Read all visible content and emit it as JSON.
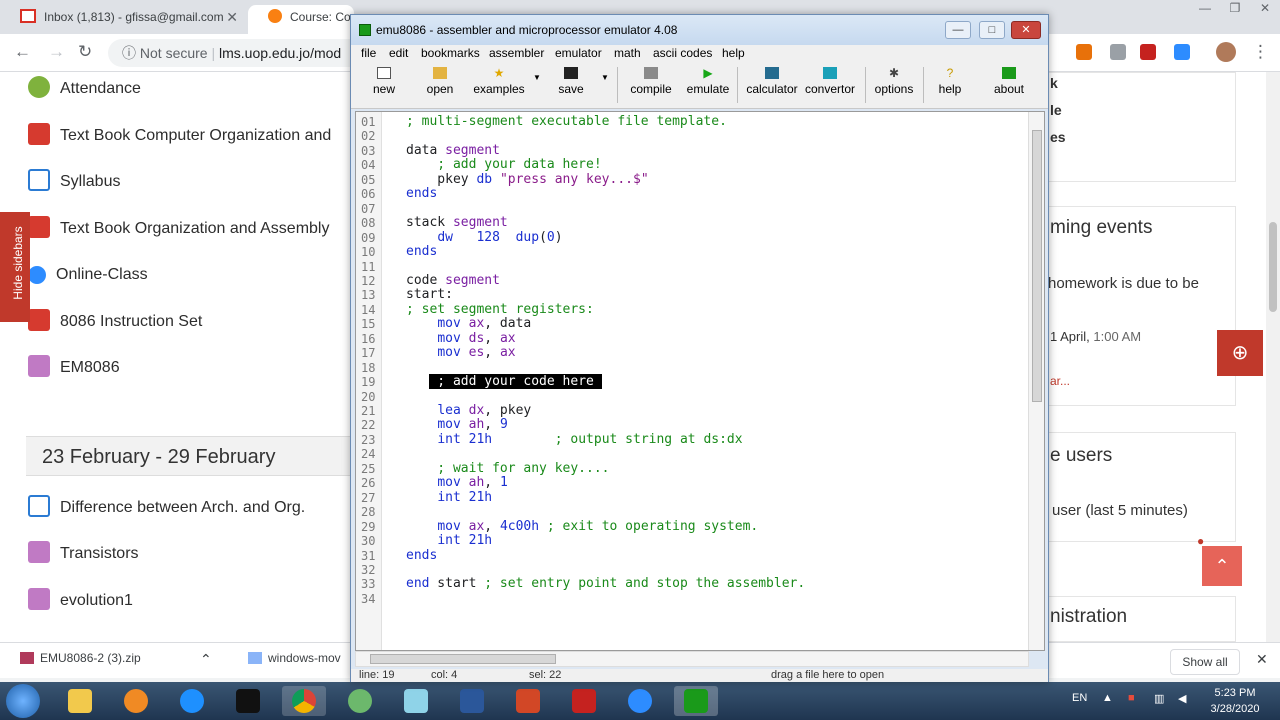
{
  "browser": {
    "tabs": [
      {
        "label": "Inbox (1,813) - gfissa@gmail.com",
        "icon": "gmail-icon"
      },
      {
        "label": "Course: Computer Organization",
        "icon": "moodle-icon"
      }
    ],
    "address": {
      "security": "Not secure",
      "url_domain": "lms.uop.edu.jo/mod"
    }
  },
  "moodle_nav": {
    "items": [
      {
        "label": "Attendance"
      },
      {
        "label": "Text Book Computer Organization and"
      },
      {
        "label": "Syllabus"
      },
      {
        "label": "Text Book Organization and Assembly"
      },
      {
        "label": "Online-Class"
      },
      {
        "label": "8086 Instruction Set"
      },
      {
        "label": "EM8086"
      }
    ],
    "week_header": "23 February - 29 February",
    "week_items": [
      {
        "label": "Difference between Arch. and Org."
      },
      {
        "label": "Transistors"
      },
      {
        "label": "evolution1"
      }
    ],
    "hide_sidebars": "Hide sidebars"
  },
  "right_panel": {
    "frag1": "k",
    "frag2": "le",
    "frag3": "es",
    "upcoming_title": "ming events",
    "event_text": "homework is due to be",
    "event_date_bold": "1 April,",
    "event_time": "1:00 AM",
    "calendar_link": "ar...",
    "online_title": "e users",
    "online_text": "user (last 5 minutes)",
    "admin_title": "nistration"
  },
  "downloads": {
    "items": [
      {
        "label": "EMU8086-2 (3).zip"
      },
      {
        "label": "windows-mov"
      }
    ],
    "show_all": "Show all"
  },
  "taskbar": {
    "lang": "EN",
    "time": "5:23 PM",
    "date": "3/28/2020"
  },
  "emu": {
    "title": "emu8086 - assembler and microprocessor emulator 4.08",
    "menu": [
      "file",
      "edit",
      "bookmarks",
      "assembler",
      "emulator",
      "math",
      "ascii codes",
      "help"
    ],
    "toolbar": [
      "new",
      "open",
      "examples",
      "save",
      "compile",
      "emulate",
      "calculator",
      "convertor",
      "options",
      "help",
      "about"
    ],
    "code": [
      {
        "n": "01",
        "t": "; multi-segment executable file template."
      },
      {
        "n": "02",
        "t": ""
      },
      {
        "n": "03",
        "t": "data segment"
      },
      {
        "n": "04",
        "t": "    ; add your data here!"
      },
      {
        "n": "05",
        "t": "    pkey db \"press any key...$\""
      },
      {
        "n": "06",
        "t": "ends"
      },
      {
        "n": "07",
        "t": ""
      },
      {
        "n": "08",
        "t": "stack segment"
      },
      {
        "n": "09",
        "t": "    dw   128  dup(0)"
      },
      {
        "n": "10",
        "t": "ends"
      },
      {
        "n": "11",
        "t": ""
      },
      {
        "n": "12",
        "t": "code segment"
      },
      {
        "n": "13",
        "t": "start:"
      },
      {
        "n": "14",
        "t": "; set segment registers:"
      },
      {
        "n": "15",
        "t": "    mov ax, data"
      },
      {
        "n": "16",
        "t": "    mov ds, ax"
      },
      {
        "n": "17",
        "t": "    mov es, ax"
      },
      {
        "n": "18",
        "t": ""
      },
      {
        "n": "19",
        "t": "    ; add your code here"
      },
      {
        "n": "20",
        "t": ""
      },
      {
        "n": "21",
        "t": "    lea dx, pkey"
      },
      {
        "n": "22",
        "t": "    mov ah, 9"
      },
      {
        "n": "23",
        "t": "    int 21h        ; output string at ds:dx"
      },
      {
        "n": "24",
        "t": ""
      },
      {
        "n": "25",
        "t": "    ; wait for any key...."
      },
      {
        "n": "26",
        "t": "    mov ah, 1"
      },
      {
        "n": "27",
        "t": "    int 21h"
      },
      {
        "n": "28",
        "t": ""
      },
      {
        "n": "29",
        "t": "    mov ax, 4c00h ; exit to operating system."
      },
      {
        "n": "30",
        "t": "    int 21h"
      },
      {
        "n": "31",
        "t": "ends"
      },
      {
        "n": "32",
        "t": ""
      },
      {
        "n": "33",
        "t": "end start ; set entry point and stop the assembler."
      },
      {
        "n": "34",
        "t": ""
      }
    ],
    "status": {
      "line": "line: 19",
      "col": "col: 4",
      "sel": "sel: 22",
      "hint": "drag a file here to open"
    }
  },
  "colors": {
    "moodle_red": "#c0392b",
    "emu_keyword_purple": "#7a1fa2",
    "emu_comment_green": "#1a8a1a",
    "emu_register_blue": "#1a2fd0"
  }
}
